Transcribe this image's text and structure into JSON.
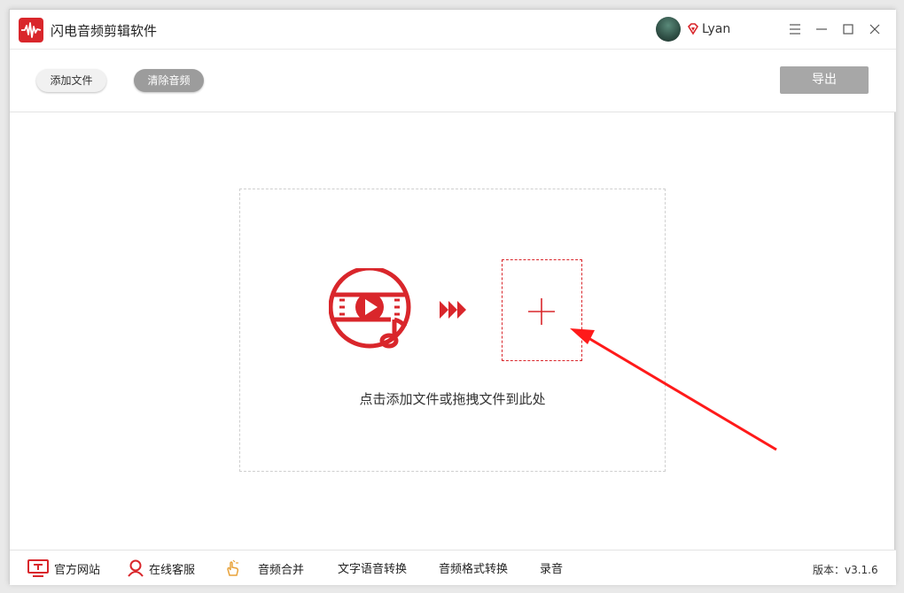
{
  "app": {
    "title": "闪电音频剪辑软件",
    "logo_icon": "audio-waveform-icon",
    "accent_color": "#d9262b"
  },
  "user": {
    "name": "Lyan",
    "badge_icon": "vip-diamond-icon"
  },
  "window_controls": [
    "menu-icon",
    "minimize-icon",
    "maximize-icon",
    "close-icon"
  ],
  "toolbar": {
    "add_file_label": "添加文件",
    "clear_audio_label": "清除音频",
    "export_label": "导出"
  },
  "drop_zone": {
    "hint": "点击添加文件或拖拽文件到此处",
    "media_icon": "video-music-disc-icon",
    "arrows_icon": "triple-chevron-right-icon",
    "add_icon": "plus-icon"
  },
  "footer": {
    "items": [
      {
        "label": "官方网站",
        "icon": "monitor-icon"
      },
      {
        "label": "在线客服",
        "icon": "user-service-icon"
      },
      {
        "label": "音频合并",
        "icon": "hand-click-icon"
      },
      {
        "label": "文字语音转换",
        "icon": ""
      },
      {
        "label": "音频格式转换",
        "icon": ""
      },
      {
        "label": "录音",
        "icon": ""
      }
    ],
    "version": "版本：v3.1.6"
  }
}
